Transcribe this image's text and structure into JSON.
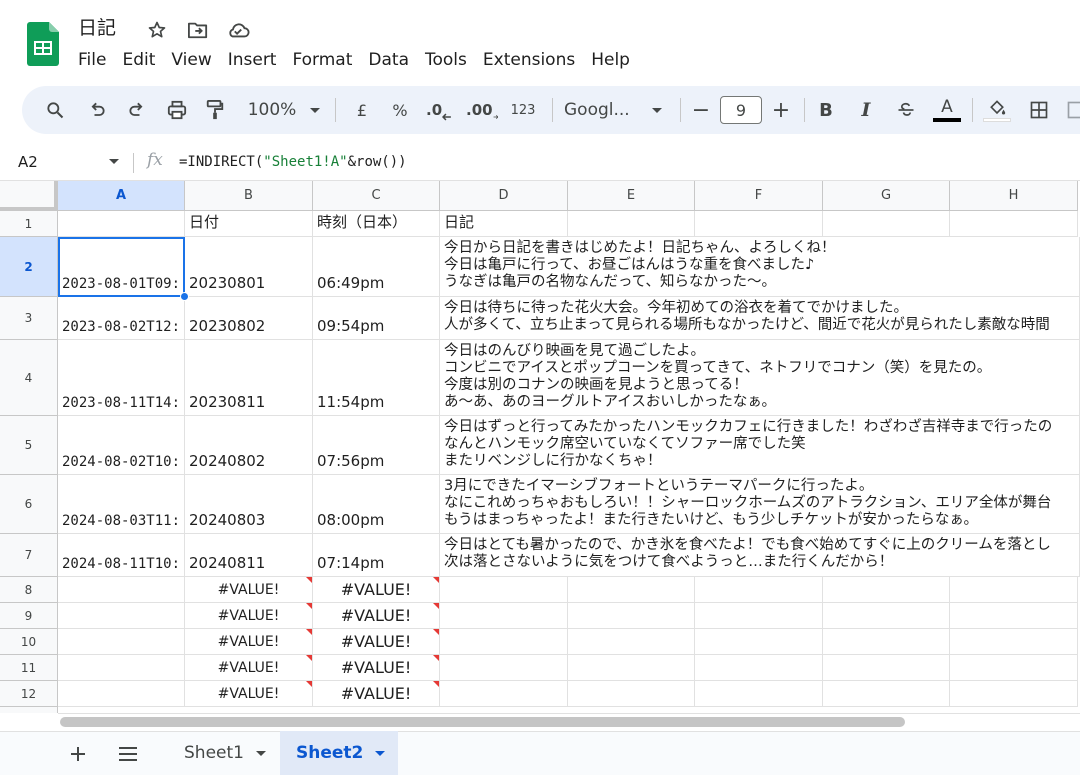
{
  "app": {
    "doc_title": "日記",
    "menu": [
      "File",
      "Edit",
      "View",
      "Insert",
      "Format",
      "Data",
      "Tools",
      "Extensions",
      "Help"
    ]
  },
  "toolbar": {
    "zoom": "100%",
    "currency": "£",
    "percent": "%",
    "decrease_decimal": ".0",
    "increase_decimal": ".00",
    "number_format": "123",
    "font_name": "Googl...",
    "font_size": "9",
    "minus": "−",
    "plus": "+",
    "bold": "B",
    "italic": "I",
    "text_color_letter": "A"
  },
  "formula_bar": {
    "cell_ref": "A2",
    "fx": "fx",
    "formula_start": "=INDIRECT(",
    "formula_string": "\"Sheet1!A\"",
    "formula_end": "&row())"
  },
  "grid": {
    "columns": [
      "A",
      "B",
      "C",
      "D",
      "E",
      "F",
      "G",
      "H"
    ],
    "row_numbers": [
      "1",
      "2",
      "3",
      "4",
      "5",
      "6",
      "7",
      "8",
      "9",
      "10",
      "11",
      "12"
    ],
    "header_row": {
      "b": "日付",
      "c": "時刻（日本）",
      "d": "日記"
    },
    "rows": [
      {
        "a": "2023-08-01T09:",
        "b": "20230801",
        "c": "06:49pm",
        "d": "今日から日記を書きはじめたよ！日記ちゃん、よろしくね！\n今日は亀戸に行って、お昼ごはんはうな重を食べました♪\nうなぎは亀戸の名物なんだって、知らなかった〜。"
      },
      {
        "a": "2023-08-02T12:",
        "b": "20230802",
        "c": "09:54pm",
        "d": "今日は待ちに待った花火大会。今年初めての浴衣を着てでかけました。\n人が多くて、立ち止まって見られる場所もなかったけど、間近で花火が見られたし素敵な時間"
      },
      {
        "a": "2023-08-11T14:",
        "b": "20230811",
        "c": "11:54pm",
        "d": "今日はのんびり映画を見て過ごしたよ。\nコンビニでアイスとポップコーンを買ってきて、ネトフリでコナン（笑）を見たの。\n今度は別のコナンの映画を見ようと思ってる！\nあ〜あ、あのヨーグルトアイスおいしかったなぁ。"
      },
      {
        "a": "2024-08-02T10:",
        "b": "20240802",
        "c": "07:56pm",
        "d": "今日はずっと行ってみたかったハンモックカフェに行きました！わざわざ吉祥寺まで行ったの\nなんとハンモック席空いていなくてソファー席でした笑\nまたリベンジしに行かなくちゃ！"
      },
      {
        "a": "2024-08-03T11:",
        "b": "20240803",
        "c": "08:00pm",
        "d": "3月にできたイマーシブフォートというテーマパークに行ったよ。\nなにこれめっちゃおもしろい！！シャーロックホームズのアトラクション、エリア全体が舞台\nもうはまっちゃったよ！また行きたいけど、もう少しチケットが安かったらなぁ。"
      },
      {
        "a": "2024-08-11T10:",
        "b": "20240811",
        "c": "07:14pm",
        "d": "今日はとても暑かったので、かき氷を食べたよ！でも食べ始めてすぐに上のクリームを落とし\n次は落とさないように気をつけて食べようっと…また行くんだから！"
      }
    ],
    "error_value": "#VALUE!"
  },
  "sheets": {
    "tabs": [
      "Sheet1",
      "Sheet2"
    ],
    "active": "Sheet2"
  },
  "colors": {
    "accent": "#0b57d0",
    "selection": "#1a73e8",
    "header_selected_bg": "#d3e3fd",
    "toolbar_bg": "#edf2fa",
    "sheets_green": "#0f9d58",
    "error_red": "#e53935"
  }
}
